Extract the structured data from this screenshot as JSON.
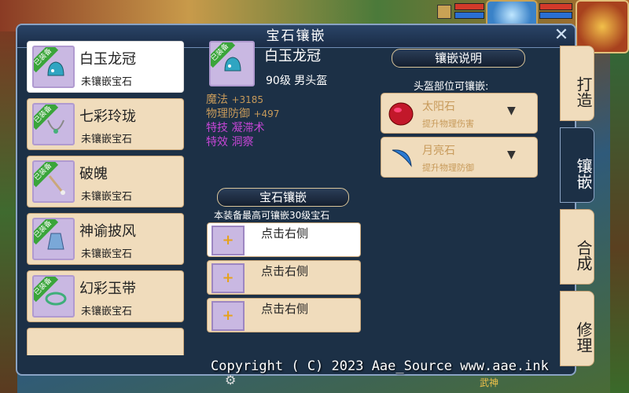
{
  "window": {
    "title": "宝石镶嵌",
    "close_symbol": "✕"
  },
  "items": [
    {
      "name": "白玉龙冠",
      "status": "未镶嵌宝石",
      "badge": "已装备",
      "selected": true,
      "icon": "helmet-icon"
    },
    {
      "name": "七彩玲珑",
      "status": "未镶嵌宝石",
      "badge": "已装备",
      "selected": false,
      "icon": "necklace-icon"
    },
    {
      "name": "破魄",
      "status": "未镶嵌宝石",
      "badge": "已装备",
      "selected": false,
      "icon": "weapon-icon"
    },
    {
      "name": "神谕披风",
      "status": "未镶嵌宝石",
      "badge": "已装备",
      "selected": false,
      "icon": "cape-icon"
    },
    {
      "name": "幻彩玉带",
      "status": "未镶嵌宝石",
      "badge": "已装备",
      "selected": false,
      "icon": "belt-icon"
    }
  ],
  "detail": {
    "badge": "已装备",
    "name": "白玉龙冠",
    "level": "90级  男头盔",
    "stats": [
      {
        "key": "魔法",
        "value": "+3185",
        "color": "#c79a5a"
      },
      {
        "key": "物理防御",
        "value": "+497",
        "color": "#c79a5a"
      },
      {
        "key": "特技",
        "value": "凝滞术",
        "color": "#c646d6"
      },
      {
        "key": "特效",
        "value": "洞察",
        "color": "#c646d6"
      }
    ]
  },
  "gem_section": {
    "header": "宝石镶嵌",
    "hint": "本装备最高可镶嵌30级宝石",
    "slots": [
      {
        "text": "点击右侧",
        "plus": "+"
      },
      {
        "text": "点击右侧",
        "plus": "+"
      },
      {
        "text": "点击右侧",
        "plus": "+"
      }
    ]
  },
  "inlay_info": {
    "header": "镶嵌说明",
    "hint": "头盔部位可镶嵌:",
    "gems": [
      {
        "name": "太阳石",
        "desc": "提升物理伤害",
        "icon": "sun-gem-icon",
        "arrow": "▼"
      },
      {
        "name": "月亮石",
        "desc": "提升物理防御",
        "icon": "moon-gem-icon",
        "arrow": "▼"
      }
    ]
  },
  "tabs": [
    {
      "label": "打造",
      "active": false
    },
    {
      "label": "镶嵌",
      "active": true
    },
    {
      "label": "合成",
      "active": false
    },
    {
      "label": "修理",
      "active": false
    }
  ],
  "footer": {
    "copyright": "Copyright ( C) 2023 Aae_Source www.aae.ink",
    "game_label": "武神",
    "gear_icon": "⚙"
  },
  "colors": {
    "panel_bg": "#1c3046",
    "card_bg": "#f0dcbc",
    "selected_bg": "#ffffff",
    "stat_gold": "#c79a5a",
    "stat_purple": "#c646d6",
    "slot_icon_bg": "#c9b8e2"
  }
}
